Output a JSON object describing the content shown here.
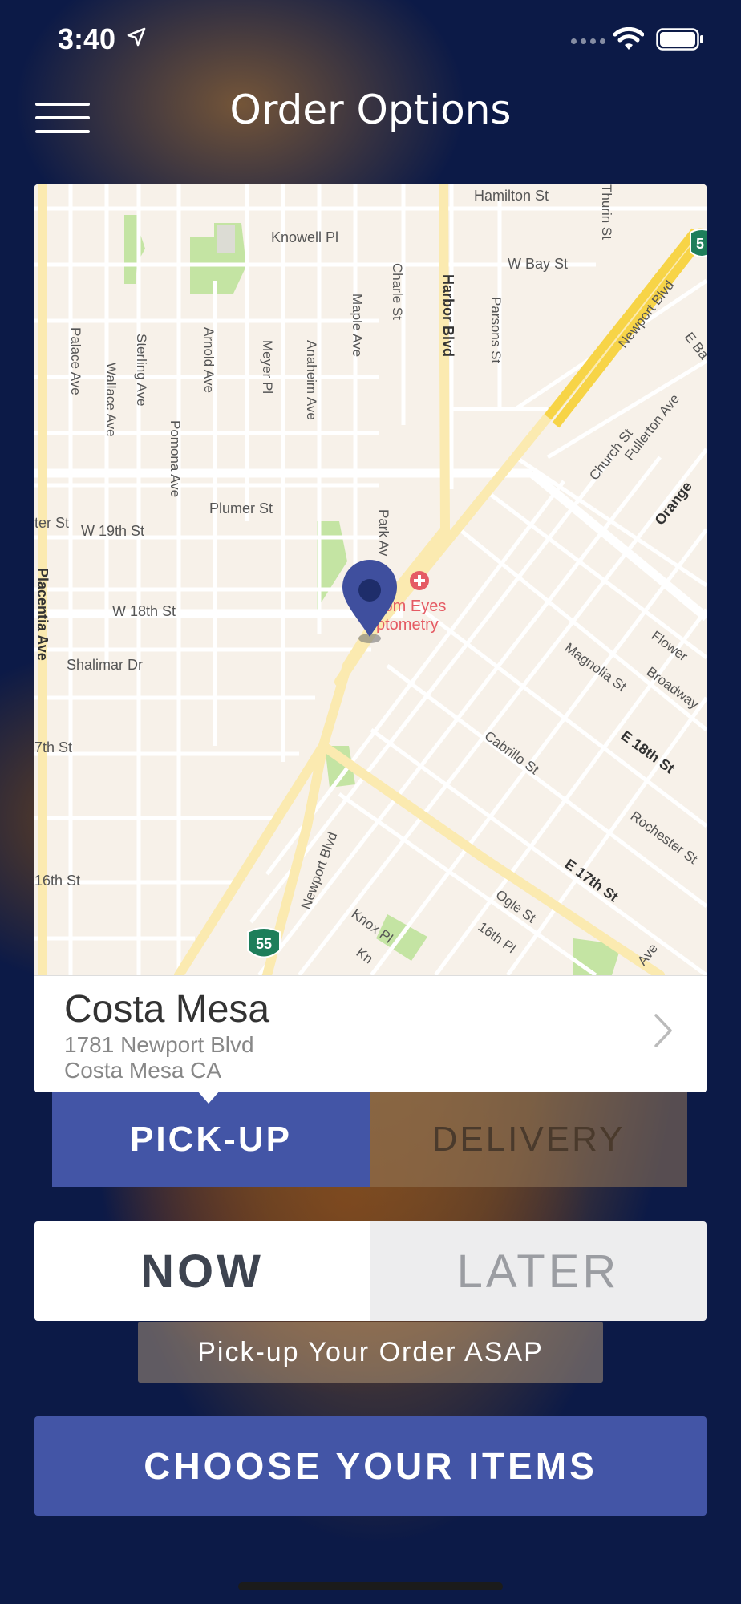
{
  "status_bar": {
    "time": "3:40"
  },
  "header": {
    "title": "Order Options"
  },
  "map": {
    "streets": {
      "hamilton": "Hamilton St",
      "thurin": "Thurin St",
      "knowell": "Knowell Pl",
      "w_bay": "W Bay St",
      "charle": "Charle St",
      "harbor": "Harbor Blvd",
      "parsons": "Parsons St",
      "newport_ne": "Newport Blvd",
      "e_ba": "E Ba",
      "palace": "Palace Ave",
      "sterling": "Sterling Ave",
      "wallace": "Wallace Ave",
      "arnold": "Arnold Ave",
      "meyer": "Meyer Pl",
      "anaheim": "Anaheim Ave",
      "maple": "Maple Ave",
      "pomona": "Pomona Ave",
      "church": "Church St",
      "fullerton": "Fullerton Ave",
      "w19th": "W 19th St",
      "plumer": "Plumer St",
      "orange": "Orange",
      "ter": "ter St",
      "park": "Park Av",
      "placentia": "Placentia Ave",
      "w18th": "W 18th St",
      "shalimar": "Shalimar Dr",
      "magnolia": "Magnolia St",
      "flower": "Flower",
      "broadway": "Broadway",
      "seventh": "7th St",
      "cabrillo": "Cabrillo St",
      "e18th": "E 18th St",
      "rochester": "Rochester St",
      "sixteenth": "16th St",
      "newport_s": "Newport Blvd",
      "e17th": "E 17th St",
      "knox": "Knox Pl",
      "ogle": "Ogle St",
      "pl16": "16th Pl",
      "kn": "Kn",
      "ave": "Ave"
    },
    "poi": {
      "line1": "stom Eyes",
      "line2": "ptometry"
    },
    "route_shields": {
      "south": "55",
      "north": "5"
    }
  },
  "store": {
    "name": "Costa Mesa",
    "address_line1": "1781 Newport Blvd",
    "address_line2": "Costa Mesa CA"
  },
  "order_type": {
    "pickup": "PICK-UP",
    "delivery": "DELIVERY",
    "selected": "pickup"
  },
  "timing": {
    "now": "NOW",
    "later": "LATER",
    "selected": "now"
  },
  "timing_note": "Pick-up Your Order ASAP",
  "cta": {
    "label": "CHOOSE YOUR ITEMS"
  },
  "colors": {
    "accent": "#4355a6",
    "pin": "#3f4f9e",
    "highway": "#f7d447",
    "park": "#c4e4a3",
    "poi": "#e55b64"
  }
}
